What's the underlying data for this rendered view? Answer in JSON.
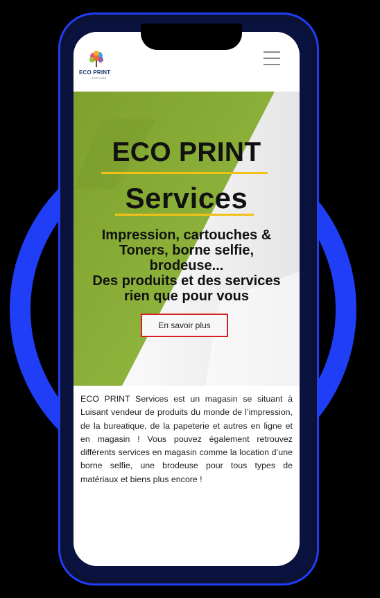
{
  "colors": {
    "ring": "#1f3ef5",
    "green": "#8db33a",
    "yellow_accent": "#f2c118",
    "cta_border": "#d42020"
  },
  "header": {
    "logo_name": "ECO PRINT",
    "logo_sub": "SERVICES",
    "menu_icon": "hamburger-menu-icon"
  },
  "hero": {
    "title_line1": "ECO PRINT",
    "title_line2": "Services",
    "tagline_lines": [
      "Impression, cartouches &",
      "Toners, borne selfie,",
      "brodeuse...",
      "Des produits et des services",
      "rien que pour vous"
    ],
    "cta_label": "En savoir plus"
  },
  "about": {
    "paragraph": "ECO PRINT Services est un magasin se situant à Luisant vendeur de produits du monde de l’impression, de la bureatique, de la papeterie et autres en ligne et en magasin ! Vous pouvez également retrouvez différents services en magasin comme la location d’une borne selfie, une brodeuse pour tous types de matériaux et biens plus encore !"
  }
}
